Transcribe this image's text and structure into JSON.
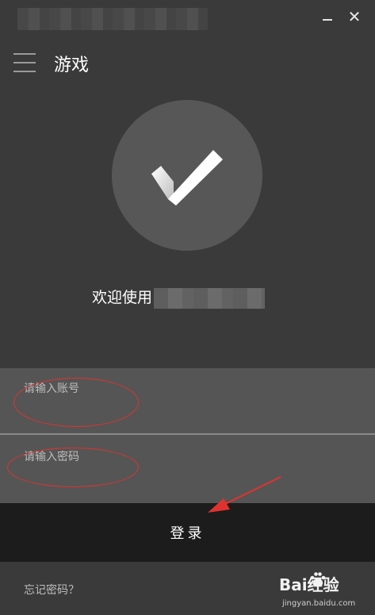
{
  "window": {
    "minimize_icon": "minimize-icon",
    "close_symbol": "✕"
  },
  "header": {
    "menu_icon": "hamburger-menu-icon",
    "title": "游戏"
  },
  "avatar": {
    "icon": "checkmark-icon"
  },
  "welcome": {
    "text": "欢迎使用"
  },
  "login_form": {
    "account_placeholder": "请输入账号",
    "password_placeholder": "请输入密码",
    "account_value": "",
    "password_value": ""
  },
  "login_button": {
    "label": "登录"
  },
  "footer": {
    "forgot_password": "忘记密码？",
    "watermark_main": "Bai经验",
    "watermark_sub": "jingyan.baidu.com"
  },
  "colors": {
    "background": "#3a3a3a",
    "field_background": "#555555",
    "login_bar": "#1c1c1c",
    "annotation_red": "#e0332f"
  }
}
